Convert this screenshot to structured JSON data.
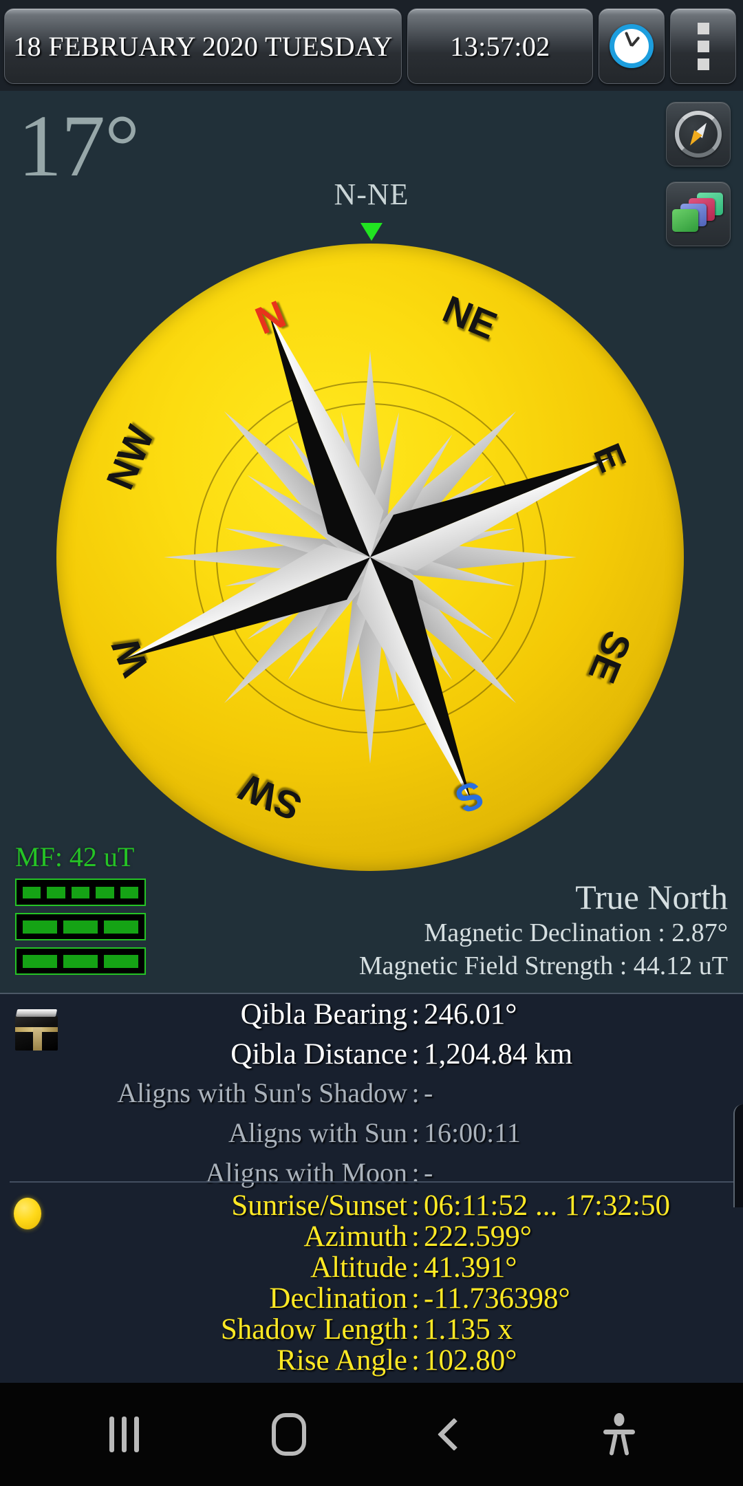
{
  "topbar": {
    "date": "18 FEBRUARY 2020  TUESDAY",
    "time": "13:57:02",
    "clock_icon": "clock-icon",
    "menu_icon": "overflow-menu-icon"
  },
  "compass": {
    "temperature": "17°",
    "heading_label": "N-NE",
    "heading_arrow_color": "#21e421",
    "disk_color": "#f3c906",
    "side_buttons": [
      {
        "name": "compass-mode-button",
        "icon": "compass-icon"
      },
      {
        "name": "layers-button",
        "icon": "cards-stack-icon"
      }
    ],
    "dial_labels": [
      {
        "text": "N",
        "color": "#e8341c",
        "angle": -22.5
      },
      {
        "text": "NE",
        "color": "#141414",
        "angle": 22.5
      },
      {
        "text": "E",
        "color": "#141414",
        "angle": 67.5
      },
      {
        "text": "SE",
        "color": "#141414",
        "angle": 112.5
      },
      {
        "text": "S",
        "color": "#2a6fe0",
        "angle": 157.5
      },
      {
        "text": "SW",
        "color": "#141414",
        "angle": 202.5
      },
      {
        "text": "W",
        "color": "#141414",
        "angle": 247.5
      },
      {
        "text": "NW",
        "color": "#141414",
        "angle": 292.5
      }
    ],
    "magnetic_field": {
      "label": "MF: 42 uT",
      "color": "#25c425",
      "rows": [
        5,
        3,
        3
      ]
    },
    "reference": {
      "title": "True North",
      "lines": [
        "Magnetic Declination : 2.87°",
        "Magnetic Field Strength : 44.12 uT"
      ]
    }
  },
  "qibla": {
    "icon": "kaaba-icon",
    "rows": [
      {
        "key": "Qibla Bearing",
        "sep": ":",
        "value": "246.01°",
        "style": "bright"
      },
      {
        "key": "Qibla Distance",
        "sep": ":",
        "value": "1,204.84 km",
        "style": "bright"
      },
      {
        "key": "Aligns with Sun's Shadow",
        "sep": ":",
        "value": "-",
        "style": "dim"
      },
      {
        "key": "Aligns with Sun",
        "sep": ":",
        "value": "16:00:11",
        "style": "dim"
      },
      {
        "key": "Aligns with Moon",
        "sep": ":",
        "value": "-",
        "style": "dim"
      }
    ]
  },
  "sun": {
    "icon": "sun-icon",
    "color": "#ffe924",
    "rows": [
      {
        "key": "Sunrise/Sunset",
        "sep": ":",
        "value": "06:11:52 ... 17:32:50"
      },
      {
        "key": "Azimuth",
        "sep": ":",
        "value": "222.599°"
      },
      {
        "key": "Altitude",
        "sep": ":",
        "value": "41.391°"
      },
      {
        "key": "Declination",
        "sep": ":",
        "value": "-11.736398°"
      },
      {
        "key": "Shadow Length",
        "sep": ":",
        "value": "1.135 x"
      },
      {
        "key": "Rise Angle",
        "sep": ":",
        "value": "102.80°"
      }
    ]
  },
  "navbar": {
    "items": [
      {
        "name": "nav-recents-button",
        "icon": "recents-icon"
      },
      {
        "name": "nav-home-button",
        "icon": "home-icon"
      },
      {
        "name": "nav-back-button",
        "icon": "back-chevron-icon"
      },
      {
        "name": "nav-accessibility-button",
        "icon": "accessibility-person-icon"
      }
    ]
  }
}
